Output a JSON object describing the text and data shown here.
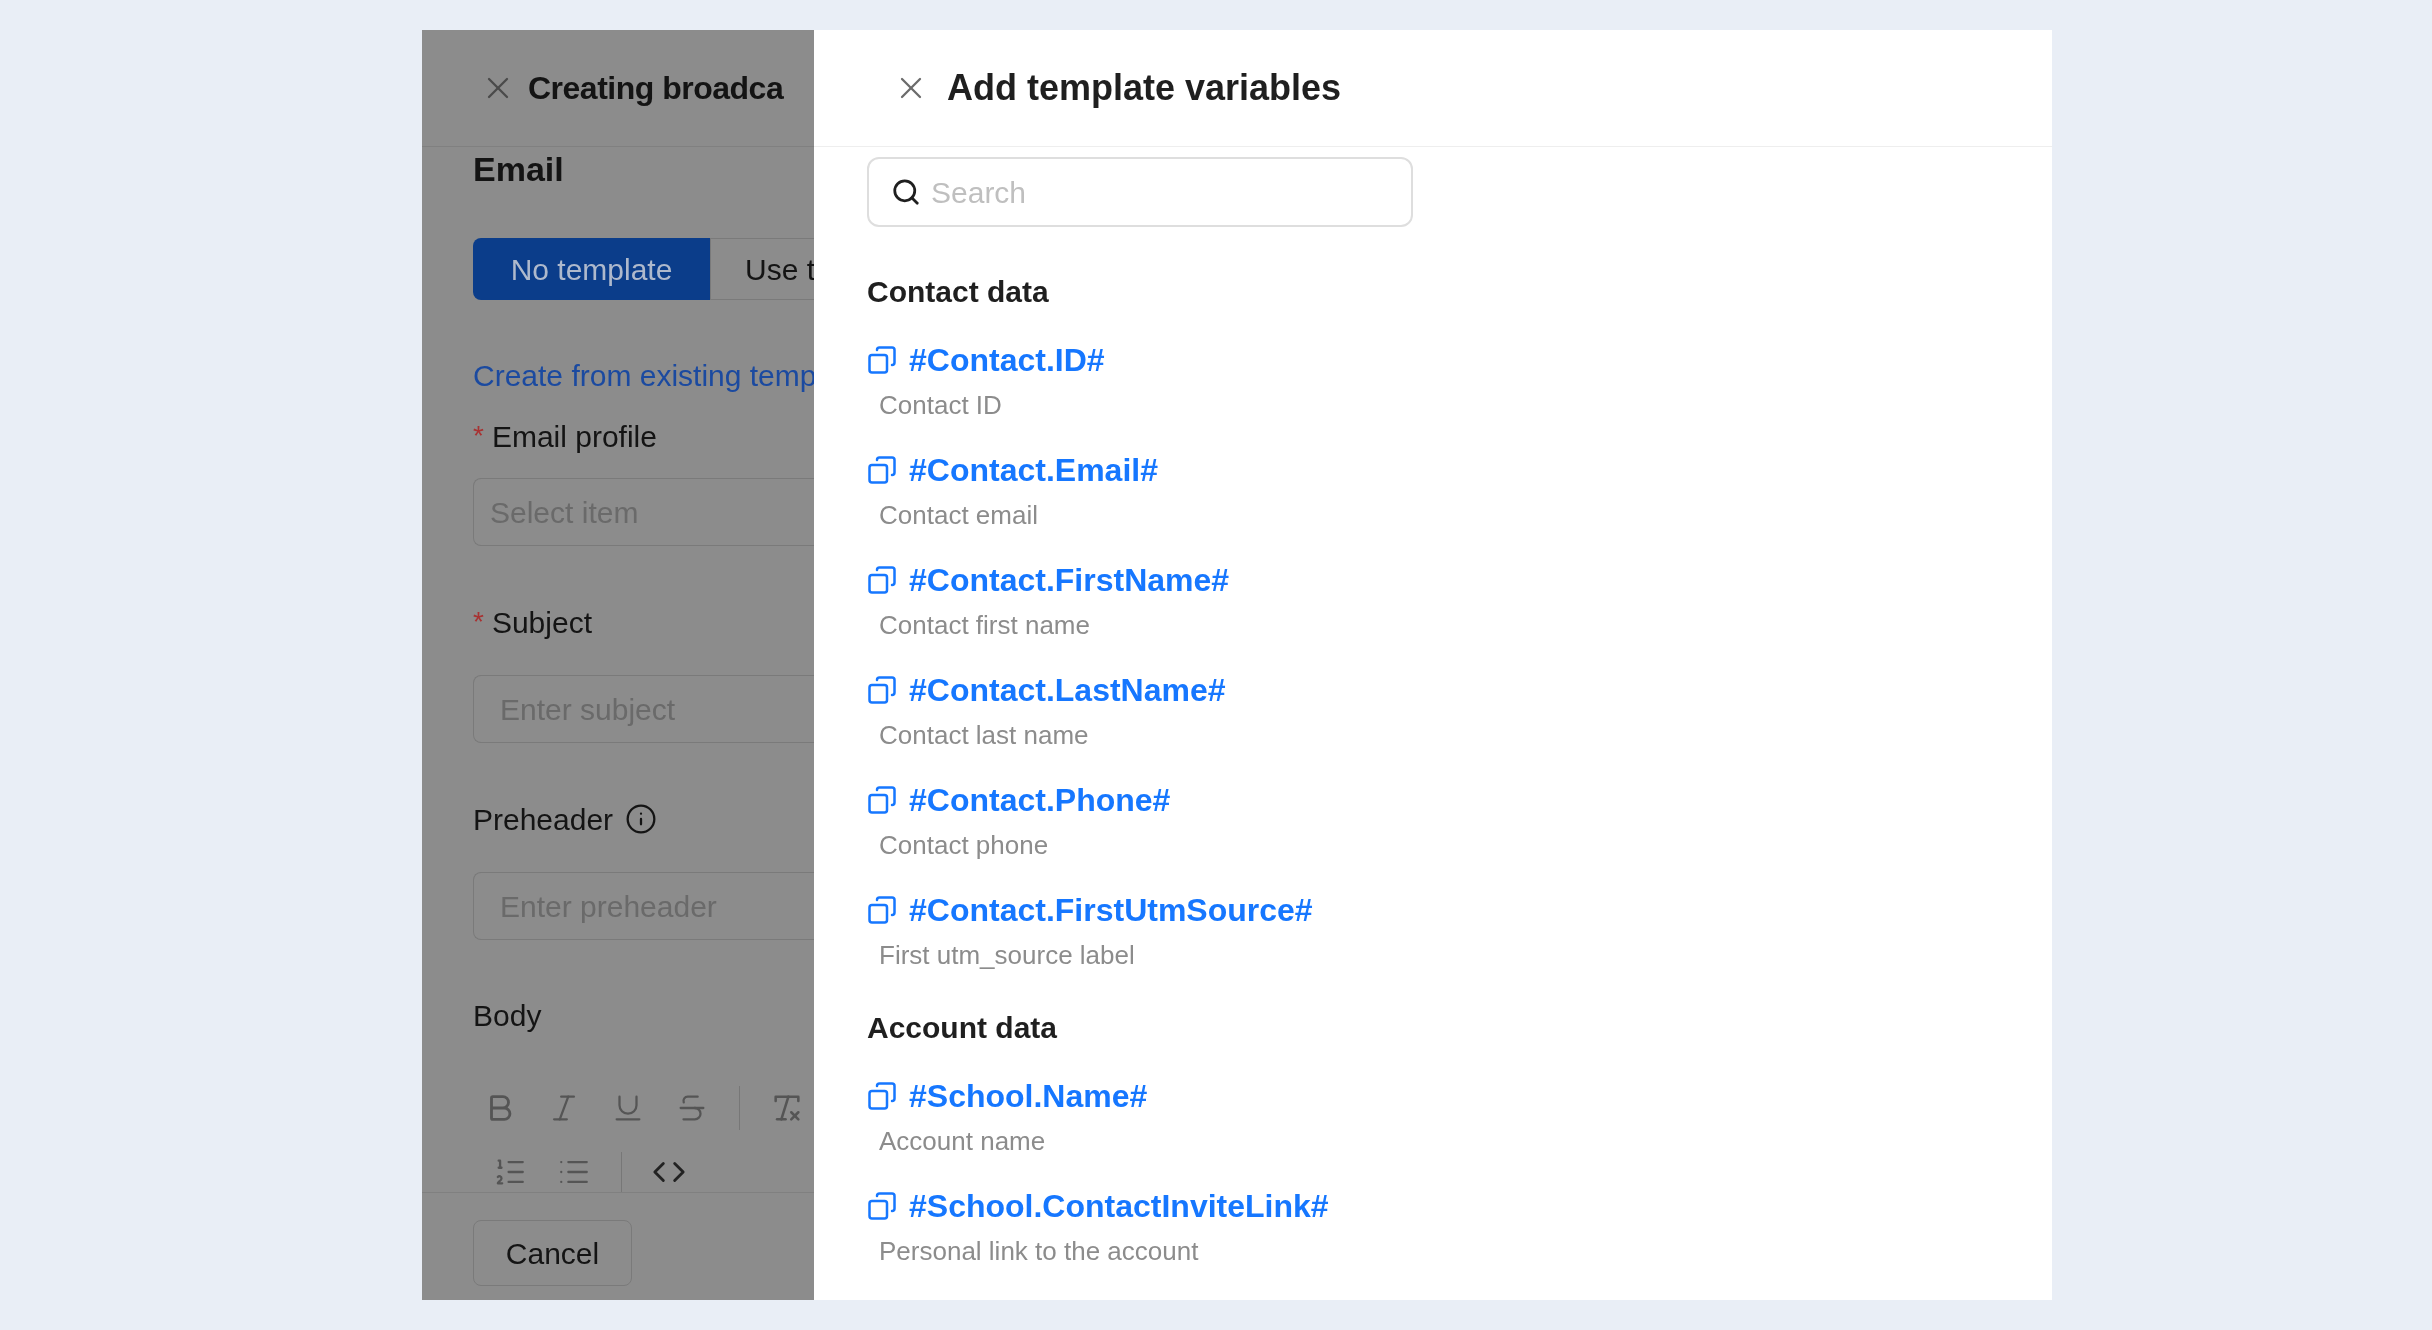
{
  "background_form": {
    "title": "Creating broadca",
    "section": "Email",
    "tabs": [
      {
        "label": "No template",
        "selected": true
      },
      {
        "label": "Use t",
        "selected": false
      }
    ],
    "link": "Create from existing temp",
    "fields": [
      {
        "label": "Email profile",
        "required_mark": "*",
        "placeholder": "Select item"
      },
      {
        "label": "Subject",
        "required_mark": "*",
        "placeholder": "Enter subject"
      },
      {
        "label": "Preheader",
        "info": true,
        "placeholder": "Enter preheader"
      }
    ],
    "body_label": "Body",
    "cancel_button": "Cancel"
  },
  "drawer": {
    "title": "Add template variables",
    "search": {
      "placeholder": "Search"
    },
    "groups": [
      {
        "title": "Contact data",
        "variables": [
          {
            "name": "#Contact.ID#",
            "description": "Contact ID"
          },
          {
            "name": "#Contact.Email#",
            "description": "Contact email"
          },
          {
            "name": "#Contact.FirstName#",
            "description": "Contact first name"
          },
          {
            "name": "#Contact.LastName#",
            "description": "Contact last name"
          },
          {
            "name": "#Contact.Phone#",
            "description": "Contact phone"
          },
          {
            "name": "#Contact.FirstUtmSource#",
            "description": "First utm_source label"
          }
        ]
      },
      {
        "title": "Account data",
        "variables": [
          {
            "name": "#School.Name#",
            "description": "Account name"
          },
          {
            "name": "#School.ContactInviteLink#",
            "description": "Personal link to the account"
          }
        ]
      }
    ]
  }
}
